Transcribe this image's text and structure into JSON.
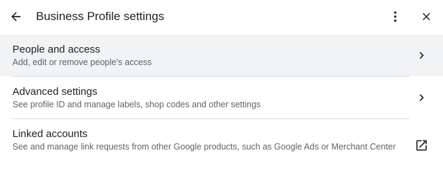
{
  "header": {
    "title": "Business Profile settings",
    "back_icon": "arrow-back-icon",
    "more_icon": "more-vert-icon",
    "close_icon": "close-icon"
  },
  "items": [
    {
      "title": "People and access",
      "subtitle": "Add, edit or remove people's access",
      "trailing_icon": "chevron-right-icon",
      "highlighted": true
    },
    {
      "title": "Advanced settings",
      "subtitle": "See profile ID and manage labels, shop codes and other settings",
      "trailing_icon": "chevron-right-icon",
      "highlighted": false
    },
    {
      "title": "Linked accounts",
      "subtitle": "See and manage link requests from other Google products, such as Google Ads or Merchant Center",
      "trailing_icon": "open-in-new-icon",
      "highlighted": false
    }
  ],
  "colors": {
    "highlight_bg": "#f1f3f4",
    "divider": "#dadce0",
    "text_primary": "#202124",
    "text_secondary": "#5f6368"
  }
}
